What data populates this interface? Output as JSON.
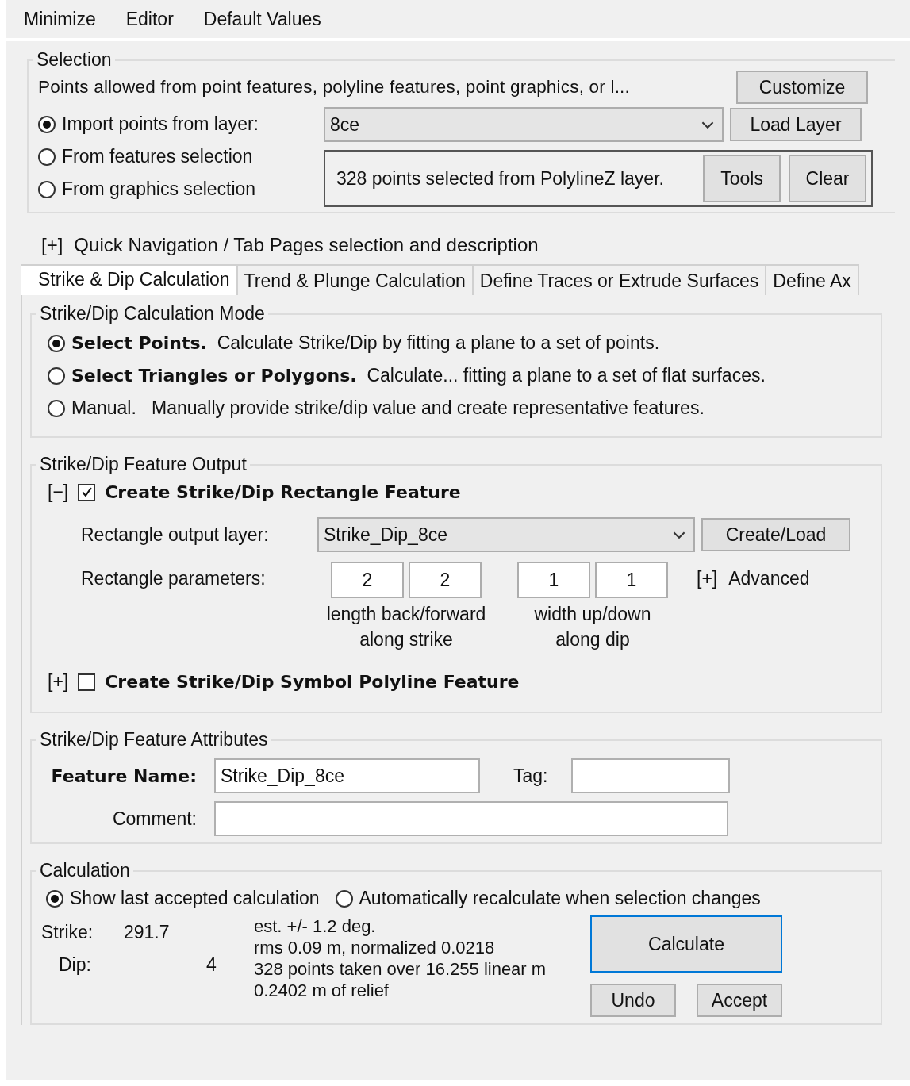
{
  "menu": [
    "Minimize",
    "Editor",
    "Default Values"
  ],
  "selection": {
    "legend": "Selection",
    "description": "Points allowed from point features, polyline features, point graphics, or l...",
    "customize_button": "Customize",
    "sources": [
      {
        "label": "Import points from layer:",
        "selected": true
      },
      {
        "label": "From features selection",
        "selected": false
      },
      {
        "label": "From graphics selection",
        "selected": false
      }
    ],
    "layer_dropdown": "8ce",
    "load_layer_button": "Load Layer",
    "status": "328 points selected from PolylineZ layer.",
    "tools_button": "Tools",
    "clear_button": "Clear"
  },
  "quick_navigation": {
    "toggle": "[+]",
    "label": "Quick Navigation / Tab Pages selection and description"
  },
  "tabs": [
    {
      "label": "Strike & Dip Calculation",
      "selected": true
    },
    {
      "label": "Trend & Plunge Calculation",
      "selected": false
    },
    {
      "label": "Define Traces or Extrude Surfaces",
      "selected": false
    },
    {
      "label": "Define Ax",
      "selected": false
    }
  ],
  "calculation_mode": {
    "legend": "Strike/Dip Calculation Mode",
    "options": [
      {
        "label": "**Select Points.**  Calculate Strike/Dip by fitting a plane to a set of points.",
        "selected": true
      },
      {
        "label": "**Select Triangles or Polygons.**  Calculate... fitting a plane to a set of flat surfaces.",
        "selected": false
      },
      {
        "label": "Manual.   Manually provide strike/dip value and create representative features.",
        "selected": false
      }
    ]
  },
  "feature_output": {
    "legend": "Strike/Dip Feature Output",
    "rectangle": {
      "toggle": "[−]",
      "label": "Create Strike/Dip Rectangle Feature",
      "checked": true,
      "output_layer_label": "Rectangle output layer:",
      "output_layer": "Strike_Dip_8ce",
      "create_load_button": "Create/Load",
      "parameters_label": "Rectangle parameters:",
      "length_values": [
        "2",
        "2"
      ],
      "length_caption": "length back/forward along strike",
      "width_values": [
        "1",
        "1"
      ],
      "width_caption": "width up/down along dip",
      "advanced_toggle": "[+]",
      "advanced_label": "Advanced"
    },
    "symbol": {
      "toggle": "[+]",
      "label": "Create Strike/Dip Symbol Polyline Feature",
      "checked": false
    }
  },
  "attributes": {
    "legend": "Strike/Dip Feature Attributes",
    "feature_name_label": "Feature Name:",
    "feature_name": "Strike_Dip_8ce",
    "tag_label": "Tag:",
    "comment_label": "Comment:"
  },
  "calculation": {
    "legend": "Calculation",
    "options": [
      {
        "label": "Show last accepted calculation",
        "selected": true
      },
      {
        "label": "Automatically recalculate when selection changes",
        "selected": false
      }
    ],
    "strike_label": "Strike:",
    "strike": "291.7",
    "dip_label": "Dip:",
    "dip": "4",
    "details": [
      "est. +/- 1.2 deg.",
      "rms 0.09 m, normalized 0.0218",
      "328 points taken over 16.255 linear m",
      "0.2402 m of relief"
    ],
    "calculate_button": "Calculate",
    "undo_button": "Undo",
    "accept_button": "Accept"
  }
}
